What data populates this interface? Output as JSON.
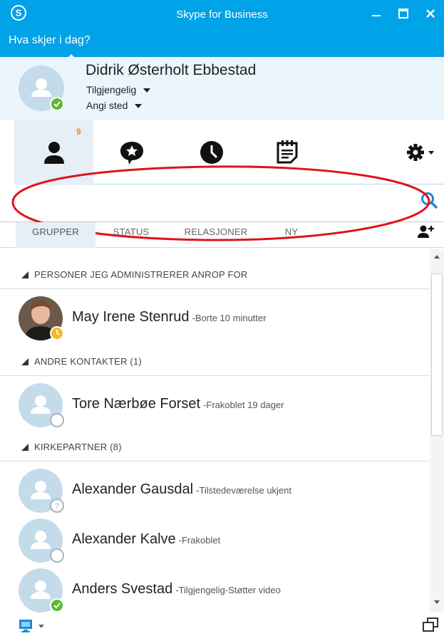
{
  "window": {
    "title": "Skype for Business",
    "minimize_label": "—",
    "maximize_label": "☐",
    "close_label": "✕"
  },
  "profile": {
    "mood": "Hva skjer i dag?",
    "name": "Didrik Østerholt Ebbestad",
    "status": "Tilgjengelig",
    "location": "Angi sted"
  },
  "nav": {
    "contacts_badge": "9",
    "icons": [
      "person-icon",
      "chat-star-icon",
      "clock-icon",
      "meetings-icon",
      "gear-icon"
    ]
  },
  "search": {
    "value": "",
    "placeholder": ""
  },
  "filters": {
    "groups": "GRUPPER",
    "status": "STATUS",
    "relationships": "RELASJONER",
    "new": "NY"
  },
  "groups": [
    {
      "label": "PERSONER JEG ADMINISTRERER ANROP FOR"
    },
    {
      "label": "ANDRE KONTAKTER (1)"
    },
    {
      "label": "KIRKEPARTNER (8)"
    }
  ],
  "contacts": [
    {
      "name": "May Irene Stenrud",
      "status": "-Borte 10 minutter",
      "presence": "away"
    },
    {
      "name": "Tore Nærbøe Forset",
      "status": "-Frakoblet 19 dager",
      "presence": "offline"
    },
    {
      "name": "Alexander Gausdal",
      "status": "-Tilstedeværelse ukjent",
      "presence": "unknown"
    },
    {
      "name": "Alexander Kalve",
      "status": "-Frakoblet",
      "presence": "offline"
    },
    {
      "name": "Anders Svestad",
      "status": "-Tilgjengelig-Støtter video",
      "presence": "available"
    }
  ],
  "colors": {
    "brand": "#00a2e8",
    "annotation": "#e0121b",
    "available": "#5cb82d",
    "away": "#f7b923",
    "badge": "#f28a1e"
  }
}
